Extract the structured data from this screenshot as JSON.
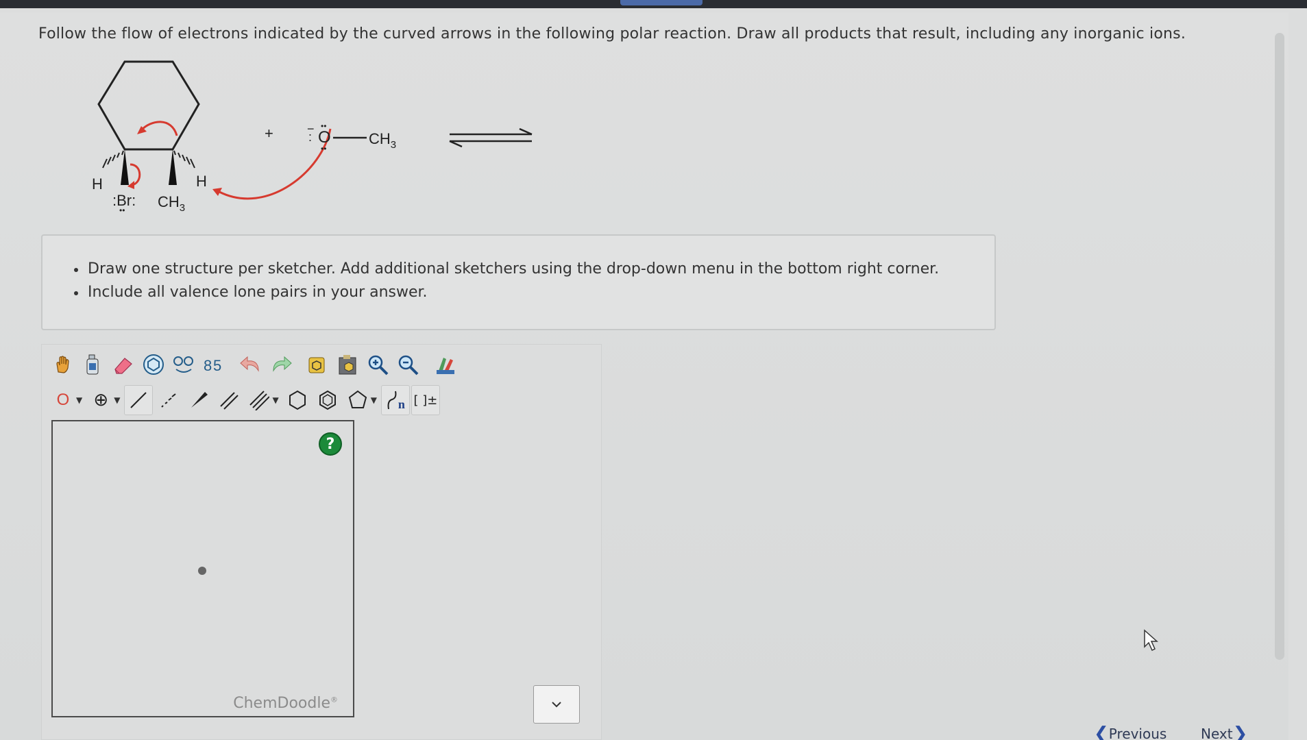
{
  "question": {
    "text": "Follow the flow of electrons indicated by the curved arrows in the following polar reaction. Draw all products that result, including any inorganic ions."
  },
  "reaction": {
    "labels": {
      "h_left": "H",
      "h_right": "H",
      "br": ":Br:",
      "ch3_ring": "CH",
      "ch3_ring_sub": "3",
      "plus": "+",
      "nucleophile_o": "O",
      "nucleophile_ch3": "CH",
      "nucleophile_ch3_sub": "3"
    },
    "arrow_color": "#d63a2f"
  },
  "instructions": {
    "items": [
      "Draw one structure per sketcher. Add additional sketchers using the drop-down menu in the bottom right corner.",
      "Include all valence lone pairs in your answer."
    ]
  },
  "sketcher": {
    "toolbar_row1": [
      "hand-icon",
      "bottle-icon",
      "eraser-icon",
      "template-icon",
      "chain-icon",
      "atom-map-icon",
      "undo-icon",
      "redo-icon",
      "copy-icon",
      "paste-icon",
      "zoom-in-icon",
      "zoom-out-icon",
      "clean-icon"
    ],
    "atom_label": "O",
    "charge_label": "⊕",
    "bracket_label": "[ ]±",
    "polymer_label": "n",
    "help_label": "?",
    "brand": "ChemDoodle",
    "brand_mark": "®"
  },
  "navigation": {
    "previous": "Previous",
    "next": "Next"
  }
}
